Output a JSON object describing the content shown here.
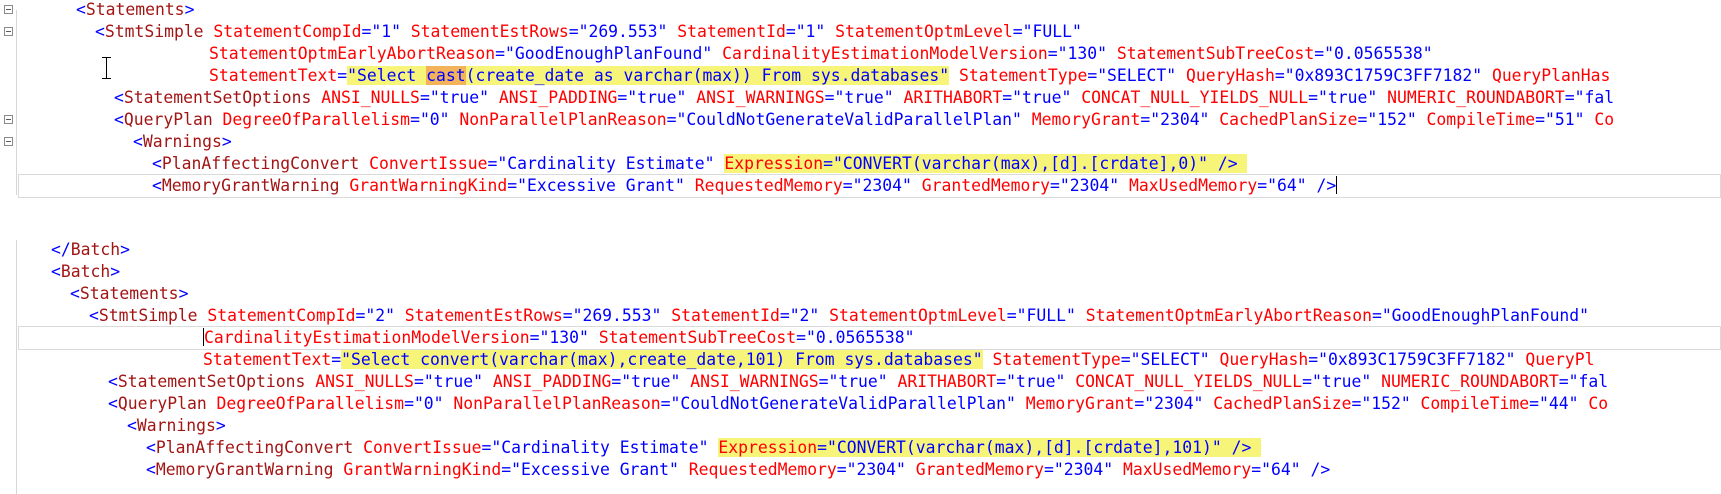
{
  "colors": {
    "bracket": "#0000ff",
    "element": "#a31515",
    "attribute": "#ff0000",
    "value": "#0000ff",
    "highlight": "#f7f47a",
    "word_highlight": "#f2b35b"
  },
  "panes": [
    {
      "lines": [
        {
          "indent": 76,
          "tokens": [
            [
              "b",
              "<"
            ],
            [
              "e",
              "Statements"
            ],
            [
              "b",
              ">"
            ]
          ],
          "fold": true
        },
        {
          "indent": 95,
          "tokens": [
            [
              "b",
              "<"
            ],
            [
              "e",
              "StmtSimple"
            ],
            [
              "a",
              " StatementCompId"
            ],
            [
              "b",
              "="
            ],
            [
              "v",
              "\"1\""
            ],
            [
              "a",
              " StatementEstRows"
            ],
            [
              "b",
              "="
            ],
            [
              "v",
              "\"269.553\""
            ],
            [
              "a",
              " StatementId"
            ],
            [
              "b",
              "="
            ],
            [
              "v",
              "\"1\""
            ],
            [
              "a",
              " StatementOptmLevel"
            ],
            [
              "b",
              "="
            ],
            [
              "v",
              "\"FULL\""
            ]
          ],
          "fold": true
        },
        {
          "indent": 209,
          "tokens": [
            [
              "a",
              "StatementOptmEarlyAbortReason"
            ],
            [
              "b",
              "="
            ],
            [
              "v",
              "\"GoodEnoughPlanFound\""
            ],
            [
              "a",
              " CardinalityEstimationModelVersion"
            ],
            [
              "b",
              "="
            ],
            [
              "v",
              "\"130\""
            ],
            [
              "a",
              " StatementSubTreeCost"
            ],
            [
              "b",
              "="
            ],
            [
              "v",
              "\"0.0565538\""
            ]
          ]
        },
        {
          "indent": 209,
          "tokens": [
            [
              "a",
              "StatementText"
            ],
            [
              "b",
              "="
            ],
            [
              "vh",
              "\"Select "
            ],
            [
              "vw",
              "cast"
            ],
            [
              "vh",
              "(create_date as varchar(max)) From sys.databases\""
            ],
            [
              "a",
              " StatementType"
            ],
            [
              "b",
              "="
            ],
            [
              "v",
              "\"SELECT\""
            ],
            [
              "a",
              " QueryHash"
            ],
            [
              "b",
              "="
            ],
            [
              "v",
              "\"0x893C1759C3FF7182\""
            ],
            [
              "a",
              " QueryPlanHas"
            ]
          ]
        },
        {
          "indent": 114,
          "tokens": [
            [
              "b",
              "<"
            ],
            [
              "e",
              "StatementSetOptions"
            ],
            [
              "a",
              " ANSI_NULLS"
            ],
            [
              "b",
              "="
            ],
            [
              "v",
              "\"true\""
            ],
            [
              "a",
              " ANSI_PADDING"
            ],
            [
              "b",
              "="
            ],
            [
              "v",
              "\"true\""
            ],
            [
              "a",
              " ANSI_WARNINGS"
            ],
            [
              "b",
              "="
            ],
            [
              "v",
              "\"true\""
            ],
            [
              "a",
              " ARITHABORT"
            ],
            [
              "b",
              "="
            ],
            [
              "v",
              "\"true\""
            ],
            [
              "a",
              " CONCAT_NULL_YIELDS_NULL"
            ],
            [
              "b",
              "="
            ],
            [
              "v",
              "\"true\""
            ],
            [
              "a",
              " NUMERIC_ROUNDABORT"
            ],
            [
              "b",
              "="
            ],
            [
              "v",
              "\"fal"
            ]
          ]
        },
        {
          "indent": 114,
          "tokens": [
            [
              "b",
              "<"
            ],
            [
              "e",
              "QueryPlan"
            ],
            [
              "a",
              " DegreeOfParallelism"
            ],
            [
              "b",
              "="
            ],
            [
              "v",
              "\"0\""
            ],
            [
              "a",
              " NonParallelPlanReason"
            ],
            [
              "b",
              "="
            ],
            [
              "v",
              "\"CouldNotGenerateValidParallelPlan\""
            ],
            [
              "a",
              " MemoryGrant"
            ],
            [
              "b",
              "="
            ],
            [
              "v",
              "\"2304\""
            ],
            [
              "a",
              " CachedPlanSize"
            ],
            [
              "b",
              "="
            ],
            [
              "v",
              "\"152\""
            ],
            [
              "a",
              " CompileTime"
            ],
            [
              "b",
              "="
            ],
            [
              "v",
              "\"51\""
            ],
            [
              "a",
              " Co"
            ]
          ],
          "fold": true
        },
        {
          "indent": 133,
          "tokens": [
            [
              "b",
              "<"
            ],
            [
              "e",
              "Warnings"
            ],
            [
              "b",
              ">"
            ]
          ],
          "fold": true
        },
        {
          "indent": 152,
          "tokens": [
            [
              "b",
              "<"
            ],
            [
              "e",
              "PlanAffectingConvert"
            ],
            [
              "a",
              " ConvertIssue"
            ],
            [
              "b",
              "="
            ],
            [
              "v",
              "\"Cardinality Estimate\""
            ],
            [
              "t",
              " "
            ],
            [
              "ah",
              "Expression"
            ],
            [
              "bh",
              "="
            ],
            [
              "vh",
              "\"CONVERT(varchar(max),[d].[crdate],0)\""
            ],
            [
              "bh",
              " /> "
            ]
          ]
        },
        {
          "indent": 152,
          "tokens": [
            [
              "b",
              "<"
            ],
            [
              "e",
              "MemoryGrantWarning"
            ],
            [
              "a",
              " GrantWarningKind"
            ],
            [
              "b",
              "="
            ],
            [
              "v",
              "\"Excessive Grant\""
            ],
            [
              "a",
              " RequestedMemory"
            ],
            [
              "b",
              "="
            ],
            [
              "v",
              "\"2304\""
            ],
            [
              "a",
              " GrantedMemory"
            ],
            [
              "b",
              "="
            ],
            [
              "v",
              "\"2304\""
            ],
            [
              "a",
              " MaxUsedMemory"
            ],
            [
              "b",
              "="
            ],
            [
              "v",
              "\"64\""
            ],
            [
              "b",
              " />"
            ]
          ],
          "current": true,
          "caret": true
        }
      ]
    },
    {
      "lines": [
        {
          "indent": 51,
          "tokens": [
            [
              "b",
              "</"
            ],
            [
              "e",
              "Batch"
            ],
            [
              "b",
              ">"
            ]
          ]
        },
        {
          "indent": 51,
          "tokens": [
            [
              "b",
              "<"
            ],
            [
              "e",
              "Batch"
            ],
            [
              "b",
              ">"
            ]
          ]
        },
        {
          "indent": 70,
          "tokens": [
            [
              "b",
              "<"
            ],
            [
              "e",
              "Statements"
            ],
            [
              "b",
              ">"
            ]
          ]
        },
        {
          "indent": 89,
          "tokens": [
            [
              "b",
              "<"
            ],
            [
              "e",
              "StmtSimple"
            ],
            [
              "a",
              " StatementCompId"
            ],
            [
              "b",
              "="
            ],
            [
              "v",
              "\"2\""
            ],
            [
              "a",
              " StatementEstRows"
            ],
            [
              "b",
              "="
            ],
            [
              "v",
              "\"269.553\""
            ],
            [
              "a",
              " StatementId"
            ],
            [
              "b",
              "="
            ],
            [
              "v",
              "\"2\""
            ],
            [
              "a",
              " StatementOptmLevel"
            ],
            [
              "b",
              "="
            ],
            [
              "v",
              "\"FULL\""
            ],
            [
              "a",
              " StatementOptmEarlyAbortReason"
            ],
            [
              "b",
              "="
            ],
            [
              "v",
              "\"GoodEnoughPlanFound\""
            ]
          ]
        },
        {
          "indent": 203,
          "tokens": [
            [
              "a",
              "CardinalityEstimationModelVersion"
            ],
            [
              "b",
              "="
            ],
            [
              "v",
              "\"130\""
            ],
            [
              "a",
              " StatementSubTreeCost"
            ],
            [
              "b",
              "="
            ],
            [
              "v",
              "\"0.0565538\""
            ]
          ],
          "current": true,
          "caret_start": true
        },
        {
          "indent": 203,
          "tokens": [
            [
              "a",
              "StatementText"
            ],
            [
              "b",
              "="
            ],
            [
              "vh",
              "\"Select convert(varchar(max),create_date,101) From sys.databases\""
            ],
            [
              "a",
              " StatementType"
            ],
            [
              "b",
              "="
            ],
            [
              "v",
              "\"SELECT\""
            ],
            [
              "a",
              " QueryHash"
            ],
            [
              "b",
              "="
            ],
            [
              "v",
              "\"0x893C1759C3FF7182\""
            ],
            [
              "a",
              " QueryPl"
            ]
          ]
        },
        {
          "indent": 108,
          "tokens": [
            [
              "b",
              "<"
            ],
            [
              "e",
              "StatementSetOptions"
            ],
            [
              "a",
              " ANSI_NULLS"
            ],
            [
              "b",
              "="
            ],
            [
              "v",
              "\"true\""
            ],
            [
              "a",
              " ANSI_PADDING"
            ],
            [
              "b",
              "="
            ],
            [
              "v",
              "\"true\""
            ],
            [
              "a",
              " ANSI_WARNINGS"
            ],
            [
              "b",
              "="
            ],
            [
              "v",
              "\"true\""
            ],
            [
              "a",
              " ARITHABORT"
            ],
            [
              "b",
              "="
            ],
            [
              "v",
              "\"true\""
            ],
            [
              "a",
              " CONCAT_NULL_YIELDS_NULL"
            ],
            [
              "b",
              "="
            ],
            [
              "v",
              "\"true\""
            ],
            [
              "a",
              " NUMERIC_ROUNDABORT"
            ],
            [
              "b",
              "="
            ],
            [
              "v",
              "\"fal"
            ]
          ]
        },
        {
          "indent": 108,
          "tokens": [
            [
              "b",
              "<"
            ],
            [
              "e",
              "QueryPlan"
            ],
            [
              "a",
              " DegreeOfParallelism"
            ],
            [
              "b",
              "="
            ],
            [
              "v",
              "\"0\""
            ],
            [
              "a",
              " NonParallelPlanReason"
            ],
            [
              "b",
              "="
            ],
            [
              "v",
              "\"CouldNotGenerateValidParallelPlan\""
            ],
            [
              "a",
              " MemoryGrant"
            ],
            [
              "b",
              "="
            ],
            [
              "v",
              "\"2304\""
            ],
            [
              "a",
              " CachedPlanSize"
            ],
            [
              "b",
              "="
            ],
            [
              "v",
              "\"152\""
            ],
            [
              "a",
              " CompileTime"
            ],
            [
              "b",
              "="
            ],
            [
              "v",
              "\"44\""
            ],
            [
              "a",
              " Co"
            ]
          ]
        },
        {
          "indent": 127,
          "tokens": [
            [
              "b",
              "<"
            ],
            [
              "e",
              "Warnings"
            ],
            [
              "b",
              ">"
            ]
          ]
        },
        {
          "indent": 146,
          "tokens": [
            [
              "b",
              "<"
            ],
            [
              "e",
              "PlanAffectingConvert"
            ],
            [
              "a",
              " ConvertIssue"
            ],
            [
              "b",
              "="
            ],
            [
              "v",
              "\"Cardinality Estimate\""
            ],
            [
              "t",
              " "
            ],
            [
              "ah",
              "Expression"
            ],
            [
              "bh",
              "="
            ],
            [
              "vh",
              "\"CONVERT(varchar(max),[d].[crdate],101)\""
            ],
            [
              "bh",
              " /> "
            ]
          ]
        },
        {
          "indent": 146,
          "tokens": [
            [
              "b",
              "<"
            ],
            [
              "e",
              "MemoryGrantWarning"
            ],
            [
              "a",
              " GrantWarningKind"
            ],
            [
              "b",
              "="
            ],
            [
              "v",
              "\"Excessive Grant\""
            ],
            [
              "a",
              " RequestedMemory"
            ],
            [
              "b",
              "="
            ],
            [
              "v",
              "\"2304\""
            ],
            [
              "a",
              " GrantedMemory"
            ],
            [
              "b",
              "="
            ],
            [
              "v",
              "\"2304\""
            ],
            [
              "a",
              " MaxUsedMemory"
            ],
            [
              "b",
              "="
            ],
            [
              "v",
              "\"64\""
            ],
            [
              "b",
              " />"
            ]
          ]
        }
      ]
    }
  ]
}
